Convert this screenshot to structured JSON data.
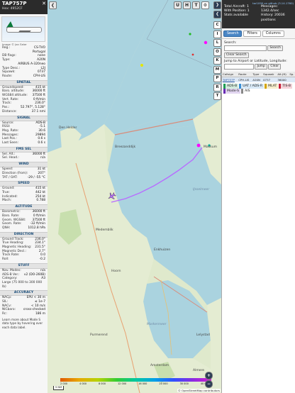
{
  "sidebar": {
    "callsign": "TAP757P",
    "hex_line": "Hex: 4952CF",
    "close": "✕",
    "image_caption": "Image © Jan Seler",
    "rows1": [
      {
        "k": "Reg.:",
        "v": "CS-TVO"
      },
      {
        "k": "",
        "v": "Portugal"
      },
      {
        "k": "DB flags:",
        "v": "none"
      },
      {
        "k": "Type:",
        "v": "A20N"
      },
      {
        "k": "",
        "v": "AIRBUS A-320neo"
      },
      {
        "k": "Type Desc.:",
        "v": "L2J"
      },
      {
        "k": "Squawk:",
        "v": "0737"
      },
      {
        "k": "Route:",
        "v": "CPH-LIS"
      }
    ],
    "sec_spatial": "SPATIAL",
    "spatial": [
      {
        "k": "Groundspeed:",
        "v": "415 kt"
      },
      {
        "k": "Baro. altitude:",
        "v": "36000 ft"
      },
      {
        "k": "WGS84 altitude:",
        "v": "37500 ft"
      },
      {
        "k": "Vert. Rate:",
        "v": "0 ft/min"
      },
      {
        "k": "Track:",
        "v": "236.0°"
      },
      {
        "k": "Pos.:",
        "v": "52.797°, 5.128°"
      },
      {
        "k": "Distance:",
        "v": "37.1 nmi"
      }
    ],
    "sec_signal": "SIGNAL",
    "signal": [
      {
        "k": "Source:",
        "v": "ADS-B"
      },
      {
        "k": "RSSI:",
        "v": "-5.1"
      },
      {
        "k": "Msg. Rate:",
        "v": "30.6"
      },
      {
        "k": "Messages:",
        "v": "29894"
      },
      {
        "k": "Last Pos.:",
        "v": "0.6 s"
      },
      {
        "k": "Last Seen:",
        "v": "0.6 s"
      }
    ],
    "sec_fms": "FMS SEL",
    "fms": [
      {
        "k": "Sel. Alt.:",
        "v": "36000 ft"
      },
      {
        "k": "Sel. Head.:",
        "v": "n/a"
      }
    ],
    "sec_wind": "WIND",
    "wind": [
      {
        "k": "Speed:",
        "v": "31 kt"
      },
      {
        "k": "Direction (from):",
        "v": "207°"
      },
      {
        "k": "TAT / OAT:",
        "v": "-29 / -55 °C"
      }
    ],
    "sec_speed": "SPEED",
    "speed": [
      {
        "k": "Ground:",
        "v": "415 kt"
      },
      {
        "k": "True:",
        "v": "442 kt"
      },
      {
        "k": "Indicated:",
        "v": "254 kt"
      },
      {
        "k": "Mach:",
        "v": "0.788"
      }
    ],
    "sec_altitude": "ALTITUDE",
    "altitude": [
      {
        "k": "Barometric:",
        "v": "36000 ft"
      },
      {
        "k": "Baro. Rate:",
        "v": "0 ft/min"
      },
      {
        "k": "Geom. WGS84:",
        "v": "37500 ft"
      },
      {
        "k": "Geom. Rate:",
        "v": "-32 ft/min"
      },
      {
        "k": "QNH:",
        "v": "1012.8 hPa"
      }
    ],
    "sec_direction": "DIRECTION",
    "direction": [
      {
        "k": "Ground Track:",
        "v": "236.0°"
      },
      {
        "k": "True Heading:",
        "v": "234.1°"
      },
      {
        "k": "Magnetic Heading:",
        "v": "231.5°"
      },
      {
        "k": "Magnetic Decl.:",
        "v": "2.7°"
      },
      {
        "k": "Track Rate:",
        "v": "0.0"
      },
      {
        "k": "Roll:",
        "v": "-0.2"
      }
    ],
    "sec_stuff": "STUFF",
    "stuff": [
      {
        "k": "Nav. Modes:",
        "v": "n/a"
      },
      {
        "k": "ADS-B Ver.:",
        "v": "v2 (DO-260B)"
      },
      {
        "k": "Category:",
        "v": "A3"
      },
      {
        "k": "Large (75 000 to 300 000 lb)",
        "v": ""
      }
    ],
    "sec_accuracy": "ACCURACY",
    "accuracy": [
      {
        "k": "NACp:",
        "v": "EPU < 30 m"
      },
      {
        "k": "SIL:",
        "v": "≤ 1e-7"
      },
      {
        "k": "NACv:",
        "v": "< 10 m/s"
      },
      {
        "k": "NICbaro:",
        "v": "cross-checked"
      },
      {
        "k": "Rc:",
        "v": "186 m"
      }
    ],
    "foot": "Learn more about Mode S data type by hovering over each data label."
  },
  "map_buttons": {
    "u": "U",
    "h": "H",
    "t": "T"
  },
  "right_buttons": [
    "C",
    "I",
    "L",
    "O",
    "K",
    "M",
    "P",
    "R",
    "T"
  ],
  "map_labels": {
    "den_helder": "Den Helder",
    "medemblik": "Medemblik",
    "markermeer": "Markermeer",
    "ijsselmeer": "IJsselmeer",
    "amsterdam": "Amsterdam",
    "lelystad": "Lelystad",
    "breezanddijk": "Breezanddijk",
    "makkum": "Makkum",
    "enkhuizen": "Enkhuizen",
    "hoorn": "Hoorn",
    "purmerend": "Purmerend",
    "almere": "Almere"
  },
  "attribution": "© OpenStreetMap contributors",
  "scale_label": "5 NM",
  "alt_labels": [
    "2 000",
    "4 000",
    "8 000",
    "12 000",
    "16 000",
    "20 000",
    "30 000",
    "40 000+"
  ],
  "zoom": {
    "in": "+",
    "out": "−"
  },
  "right": {
    "version": "tar1090 on github (3.14.1760)",
    "total_aircraft": "Total Aircraft: 1",
    "with_position": "With Position: 1",
    "messages": "Messages: 1342.4/sec",
    "history": "History: 20036 positions",
    "stats": "Stats available",
    "tabs": [
      "Search",
      "Filters",
      "Columns"
    ],
    "search_label": "Search:",
    "search_btn": "Search",
    "clear_search": "Clear Search",
    "jump_label": "Jump to Airport or Latitude, Longitude:",
    "jump_btn": "Jump",
    "clear_btn": "Clear",
    "table_headers": [
      "Callsign",
      "Route",
      "Type",
      "Squawk",
      "Alt.(ft)",
      "Sp."
    ],
    "table_row": [
      "TAP757P",
      "CPH-LIS",
      "A20N",
      "0737",
      "36000",
      ""
    ],
    "legend": [
      "ADS-B",
      "UAT / ADS-R",
      "MLAT",
      "TIS-B",
      "Mode-S",
      "AIS"
    ]
  },
  "colors": {
    "track": "#b86cff",
    "aircraft_highlight": "#ff00ff",
    "header_dark": "#2b2b2b",
    "water": "#aad3df",
    "land": "#e4ecd2"
  }
}
